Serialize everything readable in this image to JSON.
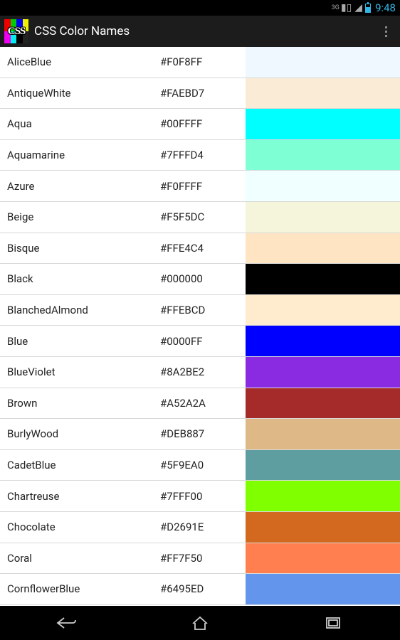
{
  "status": {
    "network": "3G",
    "time": "9:48"
  },
  "app": {
    "title": "CSS Color Names",
    "icon_text": "CSS"
  },
  "colors": [
    {
      "name": "AliceBlue",
      "hex": "#F0F8FF"
    },
    {
      "name": "AntiqueWhite",
      "hex": "#FAEBD7"
    },
    {
      "name": "Aqua",
      "hex": "#00FFFF"
    },
    {
      "name": "Aquamarine",
      "hex": "#7FFFD4"
    },
    {
      "name": "Azure",
      "hex": "#F0FFFF"
    },
    {
      "name": "Beige",
      "hex": "#F5F5DC"
    },
    {
      "name": "Bisque",
      "hex": "#FFE4C4"
    },
    {
      "name": "Black",
      "hex": "#000000"
    },
    {
      "name": "BlanchedAlmond",
      "hex": "#FFEBCD"
    },
    {
      "name": "Blue",
      "hex": "#0000FF"
    },
    {
      "name": "BlueViolet",
      "hex": "#8A2BE2"
    },
    {
      "name": "Brown",
      "hex": "#A52A2A"
    },
    {
      "name": "BurlyWood",
      "hex": "#DEB887"
    },
    {
      "name": "CadetBlue",
      "hex": "#5F9EA0"
    },
    {
      "name": "Chartreuse",
      "hex": "#7FFF00"
    },
    {
      "name": "Chocolate",
      "hex": "#D2691E"
    },
    {
      "name": "Coral",
      "hex": "#FF7F50"
    },
    {
      "name": "CornflowerBlue",
      "hex": "#6495ED"
    }
  ]
}
